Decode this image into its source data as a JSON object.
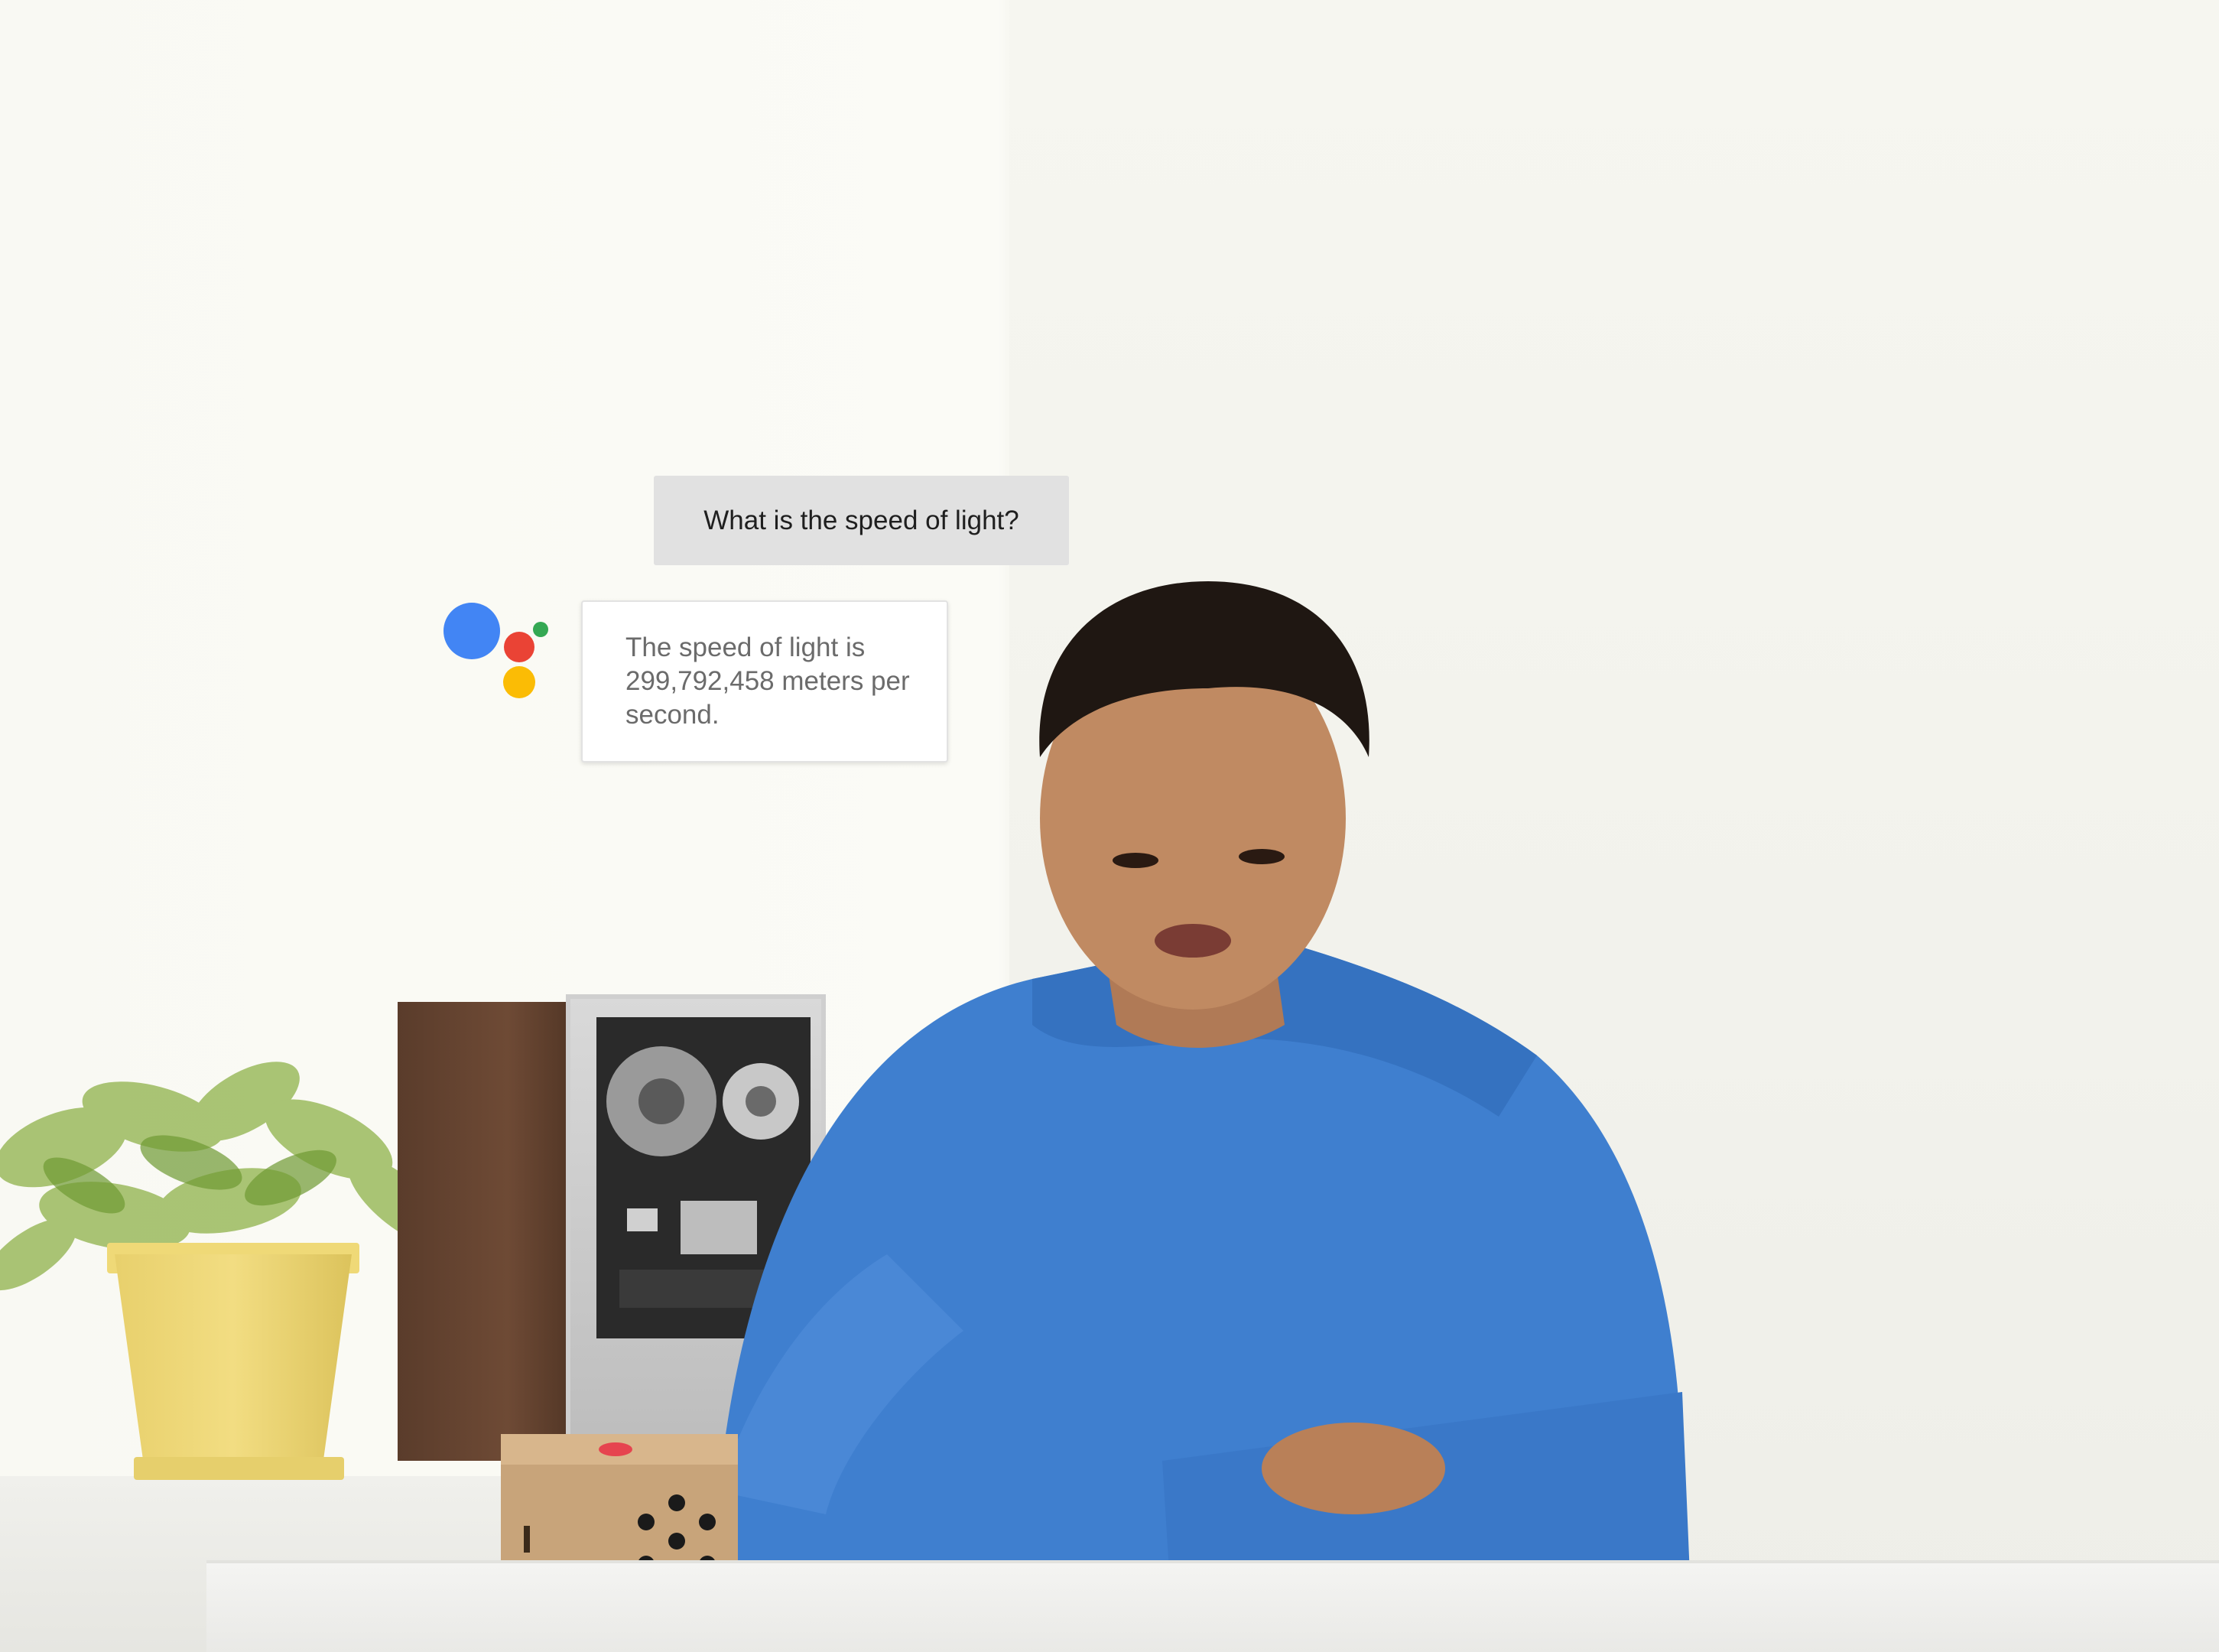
{
  "conversation": {
    "user_query": "What is the speed of light?",
    "assistant_answer": "The speed of light is 299,792,458 meters per second."
  },
  "assistant_logo": {
    "icon": "google-assistant-logo",
    "colors": [
      "#4285F4",
      "#EA4335",
      "#FBBC05",
      "#34A853"
    ]
  }
}
